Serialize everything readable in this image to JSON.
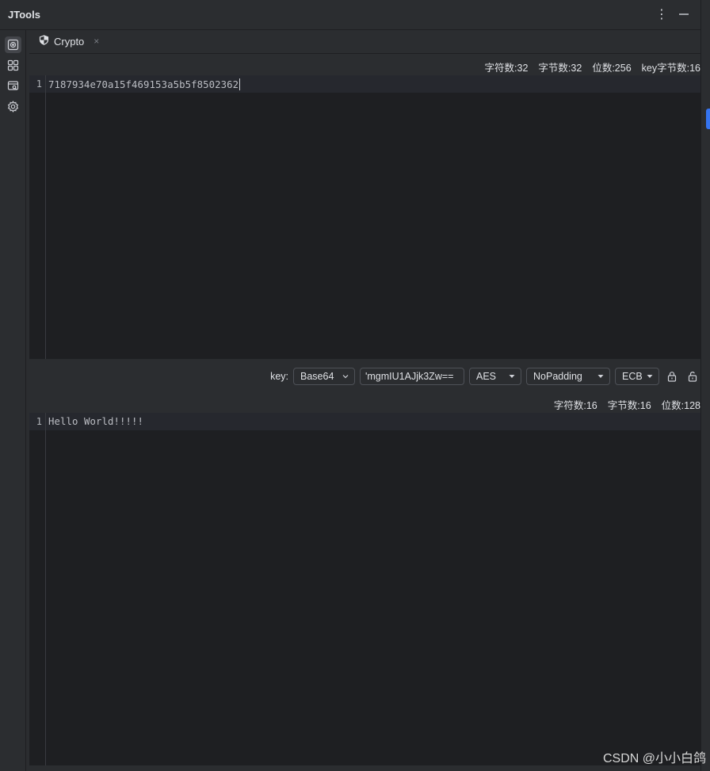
{
  "app": {
    "title": "JTools"
  },
  "tab": {
    "label": "Crypto",
    "close": "×"
  },
  "input_stats": [
    "字符数:32",
    "字节数:32",
    "位数:256",
    "key字节数:16"
  ],
  "input_editor": {
    "line_number": "1",
    "text": "7187934e70a15f469153a5b5f8502362"
  },
  "toolbar": {
    "key_label": "key:",
    "encoding": "Base64",
    "key_value": "'mgmIU1AJjk3Zw==",
    "algorithm": "AES",
    "padding": "NoPadding",
    "mode": "ECB"
  },
  "output_stats": [
    "字符数:16",
    "字节数:16",
    "位数:128"
  ],
  "output_editor": {
    "line_number": "1",
    "text": "Hello World!!!!!"
  },
  "watermark": "CSDN @小小白鸽",
  "colors": {
    "accent": "#3574f0",
    "background": "#2b2d30",
    "editor": "#1e1f22"
  }
}
